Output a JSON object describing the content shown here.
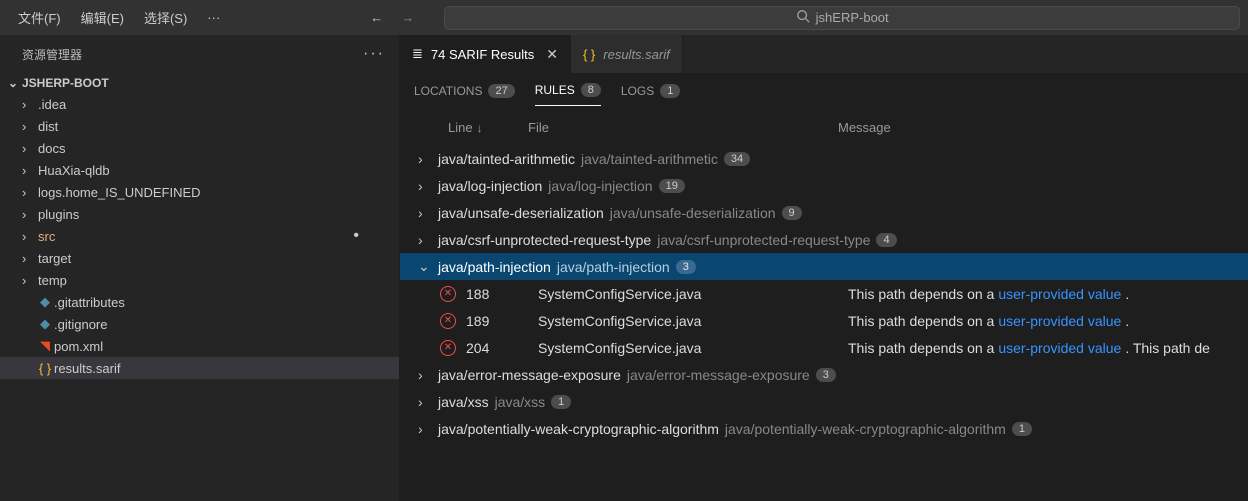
{
  "menu": {
    "file": "文件(F)",
    "edit": "编辑(E)",
    "select": "选择(S)",
    "more": "···"
  },
  "search": {
    "text": "jshERP-boot"
  },
  "sidebar": {
    "title": "资源管理器",
    "more": "···",
    "project": "JSHERP-BOOT",
    "folders": [
      {
        "name": ".idea"
      },
      {
        "name": "dist"
      },
      {
        "name": "docs"
      },
      {
        "name": "HuaXia-qldb"
      },
      {
        "name": "logs.home_IS_UNDEFINED"
      },
      {
        "name": "plugins"
      },
      {
        "name": "src",
        "modified": true
      },
      {
        "name": "target"
      },
      {
        "name": "temp"
      }
    ],
    "files": [
      {
        "name": ".gitattributes",
        "icon": "git"
      },
      {
        "name": ".gitignore",
        "icon": "git"
      },
      {
        "name": "pom.xml",
        "icon": "xml"
      },
      {
        "name": "results.sarif",
        "icon": "json",
        "selected": true
      }
    ]
  },
  "tabs": {
    "active": {
      "label": "74 SARIF Results"
    },
    "other": {
      "label": "results.sarif"
    }
  },
  "subtabs": {
    "locations": {
      "label": "LOCATIONS",
      "count": "27"
    },
    "rules": {
      "label": "RULES",
      "count": "8"
    },
    "logs": {
      "label": "LOGS",
      "count": "1"
    }
  },
  "headers": {
    "line": "Line",
    "file": "File",
    "message": "Message"
  },
  "rules": [
    {
      "name": "java/tainted-arithmetic",
      "path": "java/tainted-arithmetic",
      "count": "34"
    },
    {
      "name": "java/log-injection",
      "path": "java/log-injection",
      "count": "19"
    },
    {
      "name": "java/unsafe-deserialization",
      "path": "java/unsafe-deserialization",
      "count": "9"
    },
    {
      "name": "java/csrf-unprotected-request-type",
      "path": "java/csrf-unprotected-request-type",
      "count": "4"
    },
    {
      "name": "java/path-injection",
      "path": "java/path-injection",
      "count": "3",
      "expanded": true,
      "items": [
        {
          "line": "188",
          "file": "SystemConfigService.java",
          "msg_pre": "This path depends on a ",
          "msg_link": "user-provided value",
          "msg_post": "."
        },
        {
          "line": "189",
          "file": "SystemConfigService.java",
          "msg_pre": "This path depends on a ",
          "msg_link": "user-provided value",
          "msg_post": "."
        },
        {
          "line": "204",
          "file": "SystemConfigService.java",
          "msg_pre": "This path depends on a ",
          "msg_link": "user-provided value",
          "msg_post": ". This path de"
        }
      ]
    },
    {
      "name": "java/error-message-exposure",
      "path": "java/error-message-exposure",
      "count": "3"
    },
    {
      "name": "java/xss",
      "path": "java/xss",
      "count": "1"
    },
    {
      "name": "java/potentially-weak-cryptographic-algorithm",
      "path": "java/potentially-weak-cryptographic-algorithm",
      "count": "1"
    }
  ]
}
